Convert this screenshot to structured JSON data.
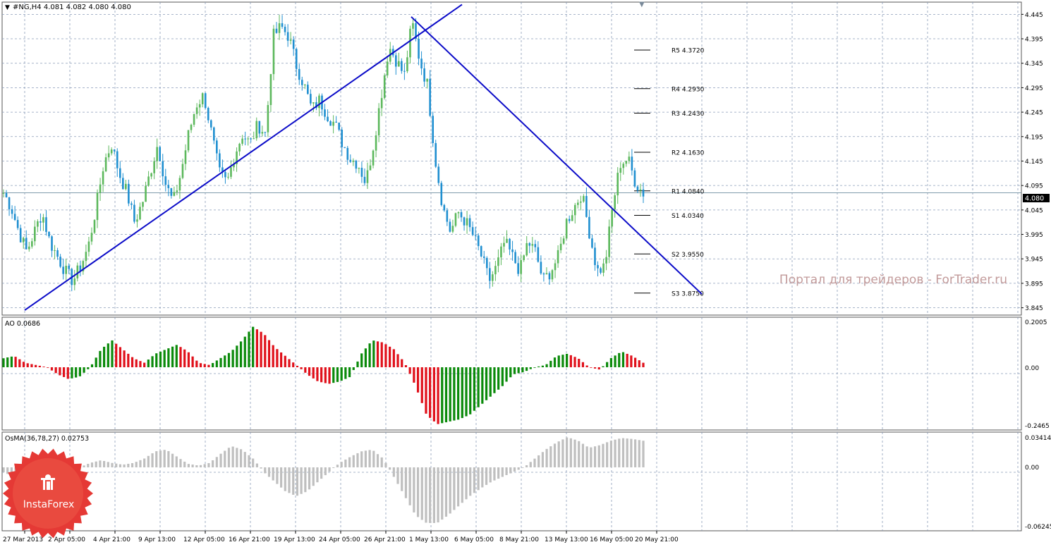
{
  "symbol_header": "#NG,H4  4.081 4.082 4.080 4.080",
  "watermark": "Портал для трейдеров - ForTrader.ru",
  "logo_text": "InstaForex",
  "colors": {
    "bull": "#5cb85c",
    "bear": "#1f8fd0",
    "trend": "#0b0bc8",
    "ao_up": "#0a8a0a",
    "ao_down": "#e0101a",
    "osma": "#bfbfbf",
    "grid": "#8a9cb8",
    "price_line": "#6f8fa0",
    "logo": "#e53935"
  },
  "price_axis": {
    "labels": [
      "4.445",
      "4.395",
      "4.345",
      "4.295",
      "4.245",
      "4.195",
      "4.145",
      "4.095",
      "4.045",
      "3.995",
      "3.945",
      "3.895",
      "3.845"
    ],
    "current": "4.080"
  },
  "ao": {
    "label": "AO 0.0686",
    "axis": [
      "0.2005",
      "0.00",
      "-0.2465"
    ]
  },
  "osma": {
    "label": "OsMA(36,78,27) 0.02753",
    "axis": [
      "0.03414",
      "0.00",
      "-0.06245"
    ]
  },
  "pivots": [
    {
      "label": "R5 4.3720",
      "value": 4.372
    },
    {
      "label": "R4 4.2930",
      "value": 4.293
    },
    {
      "label": "R3 4.2430",
      "value": 4.243
    },
    {
      "label": "R2 4.1630",
      "value": 4.163
    },
    {
      "label": "R1 4.0840",
      "value": 4.084
    },
    {
      "label": "S1 4.0340",
      "value": 4.034
    },
    {
      "label": "S2 3.9550",
      "value": 3.955
    },
    {
      "label": "S3 3.8750",
      "value": 3.875
    }
  ],
  "time_axis": [
    "27 Mar 2013",
    "2 Apr 05:00",
    "4 Apr 21:00",
    "9 Apr 13:00",
    "12 Apr 05:00",
    "16 Apr 21:00",
    "19 Apr 13:00",
    "24 Apr 05:00",
    "26 Apr 21:00",
    "1 May 13:00",
    "6 May 05:00",
    "8 May 21:00",
    "13 May 13:00",
    "16 May 05:00",
    "20 May 21:00"
  ],
  "chart_data": {
    "type": "candlestick",
    "symbol": "#NG",
    "timeframe": "H4",
    "ohlc_last": [
      4.081,
      4.082,
      4.08,
      4.08
    ],
    "y_range": [
      3.83,
      4.47
    ],
    "price_path": [
      4.08,
      4.05,
      4.0,
      3.96,
      4.0,
      4.04,
      3.98,
      3.95,
      3.92,
      3.9,
      3.93,
      3.97,
      4.05,
      4.14,
      4.18,
      4.12,
      4.08,
      4.02,
      4.06,
      4.12,
      4.18,
      4.1,
      4.06,
      4.12,
      4.2,
      4.26,
      4.28,
      4.2,
      4.12,
      4.1,
      4.16,
      4.2,
      4.18,
      4.22,
      4.2,
      4.4,
      4.42,
      4.4,
      4.34,
      4.3,
      4.25,
      4.27,
      4.24,
      4.22,
      4.18,
      4.15,
      4.14,
      4.1,
      4.18,
      4.28,
      4.38,
      4.35,
      4.32,
      4.43,
      4.35,
      4.3,
      4.15,
      4.05,
      4.0,
      4.04,
      4.02,
      3.99,
      3.95,
      3.9,
      3.93,
      3.98,
      3.95,
      3.92,
      3.98,
      3.96,
      3.9,
      3.92,
      3.95,
      4.02,
      4.05,
      4.08,
      4.0,
      3.92,
      3.93,
      4.05,
      4.14,
      4.15,
      4.1,
      4.08
    ],
    "trendlines": [
      {
        "name": "support",
        "from": {
          "date": "27 Mar 2013",
          "price": 3.84
        },
        "to": {
          "date": "1 May 13:00",
          "price": 4.46
        }
      },
      {
        "name": "resistance",
        "from": {
          "date": "1 May 13:00",
          "price": 4.44
        },
        "to": {
          "date": "20 May 21:00",
          "price": 3.87
        }
      }
    ],
    "ao_range": [
      -0.2465,
      0.2005
    ],
    "ao_path": [
      0.04,
      0.05,
      0.02,
      0.01,
      0.0,
      -0.03,
      -0.05,
      -0.04,
      0.0,
      0.08,
      0.12,
      0.08,
      0.04,
      0.02,
      0.06,
      0.08,
      0.1,
      0.07,
      0.02,
      0.01,
      0.04,
      0.07,
      0.12,
      0.18,
      0.15,
      0.09,
      0.05,
      0.01,
      -0.03,
      -0.06,
      -0.07,
      -0.06,
      -0.04,
      0.06,
      0.12,
      0.11,
      0.08,
      0.02,
      -0.08,
      -0.2,
      -0.24,
      -0.23,
      -0.22,
      -0.2,
      -0.16,
      -0.12,
      -0.08,
      -0.03,
      -0.02,
      0.0,
      0.01,
      0.05,
      0.06,
      0.04,
      0.0,
      -0.01,
      0.04,
      0.07,
      0.05,
      0.02
    ],
    "osma_range": [
      -0.06245,
      0.03414
    ],
    "osma_path": [
      -0.005,
      -0.01,
      -0.015,
      -0.02,
      -0.025,
      -0.02,
      -0.01,
      0.0,
      0.005,
      0.008,
      0.005,
      0.003,
      0.005,
      0.01,
      0.018,
      0.02,
      0.012,
      0.004,
      0.002,
      0.005,
      0.015,
      0.024,
      0.02,
      0.01,
      -0.005,
      -0.015,
      -0.025,
      -0.03,
      -0.025,
      -0.015,
      -0.005,
      0.005,
      0.012,
      0.018,
      0.02,
      0.01,
      -0.01,
      -0.03,
      -0.05,
      -0.058,
      -0.058,
      -0.05,
      -0.04,
      -0.03,
      -0.022,
      -0.015,
      -0.01,
      -0.005,
      0.0,
      0.01,
      0.02,
      0.028,
      0.034,
      0.03,
      0.022,
      0.025,
      0.03,
      0.033,
      0.032,
      0.03
    ]
  }
}
